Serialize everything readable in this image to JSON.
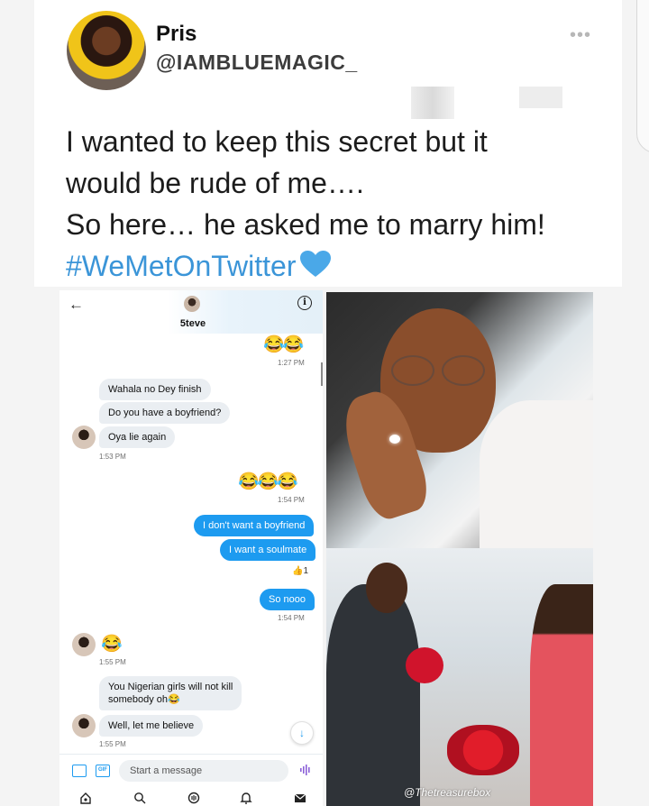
{
  "tweet": {
    "name": "Pris",
    "handle": "@IAMBLUEMAGIC_",
    "more": "•••",
    "lines": [
      "I wanted to keep this secret but it",
      "would be rude of me….",
      "So here… he asked me to marry him!"
    ],
    "hashtag": "#WeMetOnTwitter",
    "hashtag_color": "#3b95d8",
    "heart_color": "#4aa8e8"
  },
  "chat": {
    "contact_name": "5teve",
    "back": "←",
    "info": "i",
    "accent": "#1d9bf0",
    "messages": {
      "e1": "😂😂",
      "t1": "1:27 PM",
      "m1": "Wahala no Dey finish",
      "m2": "Do you have a boyfriend?",
      "m3": "Oya lie again",
      "t2": "1:53 PM",
      "e2": "😂😂😂",
      "t3": "1:54 PM",
      "m4": "I don't want a boyfriend",
      "m5": "I want a soulmate",
      "reaction": "👍1",
      "m6": "So nooo",
      "t4": "1:54 PM",
      "e3": "😂",
      "t5": "1:55 PM",
      "m7_line1": "You Nigerian girls will not kill",
      "m7_line2": "somebody oh😂",
      "m8": "Well, let me believe",
      "t6": "1:55 PM"
    },
    "composer_placeholder": "Start a message",
    "gif_label": "GIF",
    "scroll_down": "↓"
  },
  "photos": {
    "watermark": "@Thetreasurebox"
  }
}
